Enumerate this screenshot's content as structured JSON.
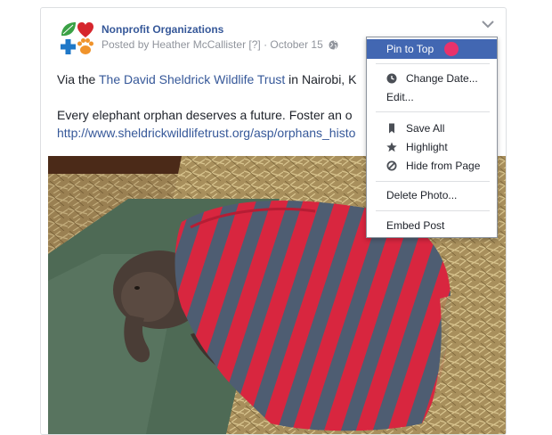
{
  "post": {
    "page_name": "Nonprofit Organizations",
    "posted_by": "Posted by Heather McCallister [?] · October 15",
    "text_prefix": "Via the ",
    "link_text": "The David Sheldrick Wildlife Trust",
    "text_suffix": " in Nairobi, K",
    "line2": "Every elephant orphan deserves a future. Foster an o",
    "url": "http://www.sheldrickwildlifetrust.org/asp/orphans_histo"
  },
  "menu": {
    "pin_to_top": "Pin to Top",
    "change_date": "Change Date...",
    "edit": "Edit...",
    "save_all": "Save All",
    "highlight": "Highlight",
    "hide_from_page": "Hide from Page",
    "delete_photo": "Delete Photo...",
    "embed_post": "Embed Post"
  },
  "colors": {
    "link": "#365899",
    "menu_active": "#4267b2",
    "cursor": "#e8326b",
    "blanket_red": "#d8263f",
    "blanket_blue": "#4e5d72"
  },
  "icons": {
    "avatar": "heart-leaf-cross-paw-logo",
    "globe": "globe-icon",
    "chevron": "chevron-down-icon",
    "change_date": "clock-icon",
    "save_all": "bookmark-icon",
    "highlight": "star-icon",
    "hide_from_page": "hide-circle-icon"
  }
}
